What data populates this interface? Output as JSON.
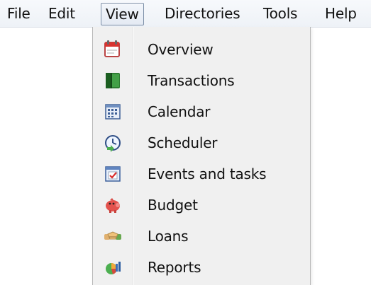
{
  "menubar": {
    "items": [
      {
        "label": "File"
      },
      {
        "label": "Edit"
      },
      {
        "label": "View"
      },
      {
        "label": "Directories"
      },
      {
        "label": "Tools"
      },
      {
        "label": "Help"
      }
    ]
  },
  "view_menu": {
    "items": [
      {
        "label": "Overview",
        "icon": "overview-calendar-icon"
      },
      {
        "label": "Transactions",
        "icon": "transactions-book-icon"
      },
      {
        "label": "Calendar",
        "icon": "calendar-grid-icon"
      },
      {
        "label": "Scheduler",
        "icon": "scheduler-clock-icon"
      },
      {
        "label": "Events and tasks",
        "icon": "events-tasks-icon"
      },
      {
        "label": "Budget",
        "icon": "piggy-bank-icon"
      },
      {
        "label": "Loans",
        "icon": "handshake-icon"
      },
      {
        "label": "Reports",
        "icon": "pie-chart-icon"
      }
    ]
  },
  "colors": {
    "menu_background": "#f0f0f0",
    "menubar_background": "#eef2f7",
    "active_border": "#7a8da6"
  }
}
